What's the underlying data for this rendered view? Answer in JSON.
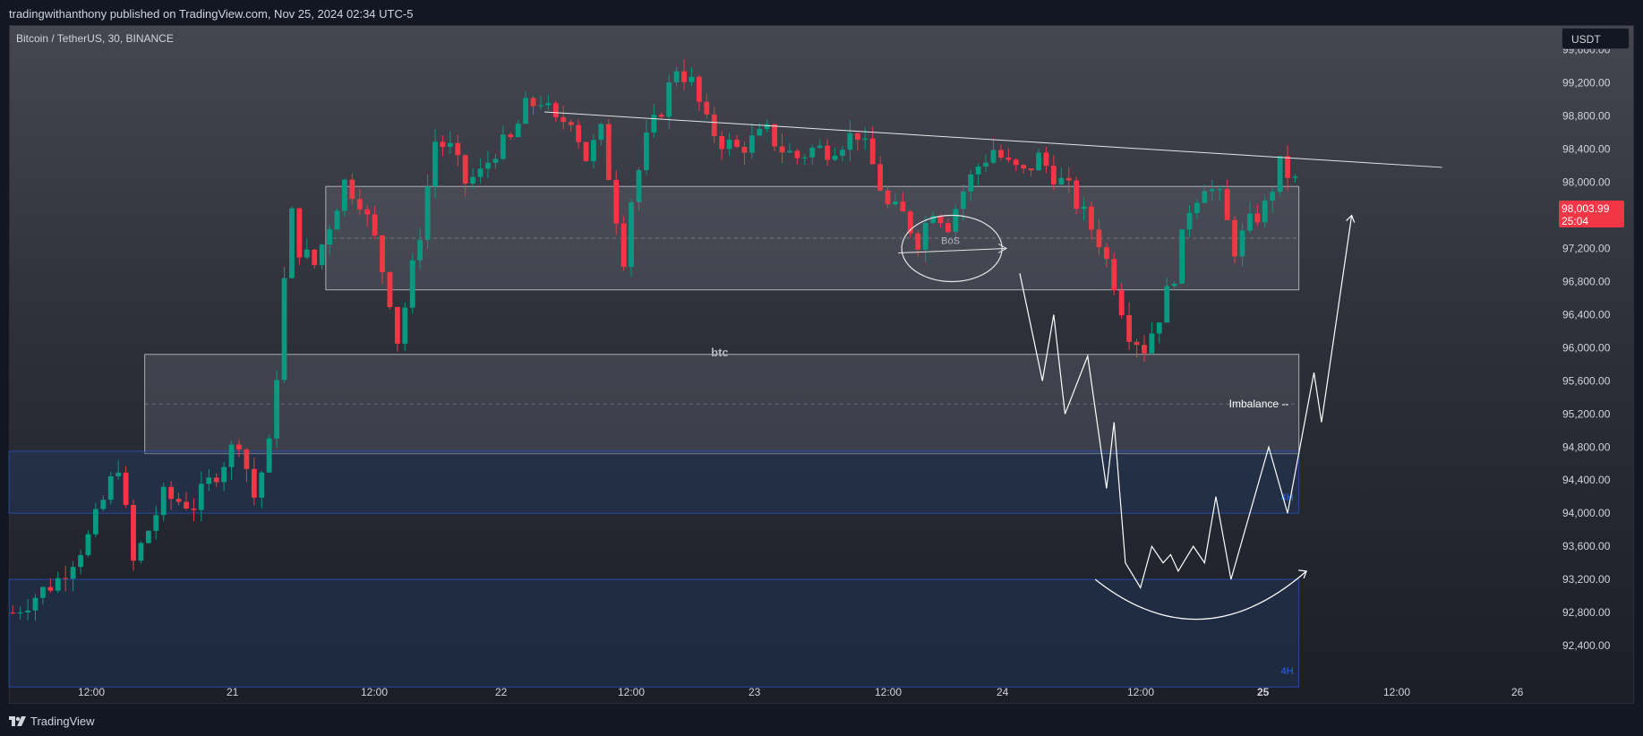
{
  "header": {
    "published_by": "tradingwithanthony published on TradingView.com, Nov 25, 2024 02:34 UTC-5",
    "symbol_line": "Bitcoin / TetherUS, 30, BINANCE",
    "currency": "USDT"
  },
  "last_price": {
    "value": "98,003.99",
    "countdown": "25:04"
  },
  "footer": {
    "brand": "TradingView",
    "logo_icon": "tradingview-logo-icon"
  },
  "colors": {
    "up": "#089981",
    "down": "#f23645",
    "zone_gray": "#787b86",
    "zone_blue": "#2962ff",
    "text": "#d1d4dc",
    "drawing": "#ffffff"
  },
  "chart_data": {
    "type": "candlestick",
    "interval": "30",
    "ylim": [
      92000,
      99900
    ],
    "yticks": [
      "99,600.00",
      "99,200.00",
      "98,800.00",
      "98,400.00",
      "98,000.00",
      "97,600.00",
      "97,200.00",
      "96,800.00",
      "96,400.00",
      "96,000.00",
      "95,600.00",
      "95,200.00",
      "94,800.00",
      "94,400.00",
      "94,000.00",
      "93,600.00",
      "93,200.00",
      "92,800.00",
      "92,400.00"
    ],
    "xticks": [
      "12:00",
      "21",
      "12:00",
      "22",
      "12:00",
      "23",
      "12:00",
      "24",
      "12:00",
      "25",
      "12:00",
      "26"
    ],
    "price_path": [
      [
        0,
        92800
      ],
      [
        6,
        93200
      ],
      [
        10,
        93700
      ],
      [
        14,
        94600
      ],
      [
        16,
        93400
      ],
      [
        20,
        94200
      ],
      [
        24,
        94100
      ],
      [
        27,
        94500
      ],
      [
        30,
        94900
      ],
      [
        32,
        94200
      ],
      [
        34,
        94800
      ],
      [
        35,
        95700
      ],
      [
        36,
        96800
      ],
      [
        37,
        97600
      ],
      [
        38,
        97200
      ],
      [
        40,
        97000
      ],
      [
        42,
        97500
      ],
      [
        44,
        98000
      ],
      [
        46,
        97800
      ],
      [
        48,
        97300
      ],
      [
        50,
        96600
      ],
      [
        51,
        96100
      ],
      [
        52,
        96500
      ],
      [
        54,
        97400
      ],
      [
        56,
        98500
      ],
      [
        58,
        98400
      ],
      [
        60,
        98000
      ],
      [
        62,
        98100
      ],
      [
        64,
        98400
      ],
      [
        66,
        98500
      ],
      [
        68,
        98900
      ],
      [
        70,
        99000
      ],
      [
        72,
        98700
      ],
      [
        74,
        98800
      ],
      [
        76,
        98300
      ],
      [
        78,
        98600
      ],
      [
        80,
        97600
      ],
      [
        81,
        97100
      ],
      [
        82,
        97800
      ],
      [
        84,
        98500
      ],
      [
        86,
        98900
      ],
      [
        88,
        99400
      ],
      [
        90,
        99200
      ],
      [
        92,
        98700
      ],
      [
        94,
        98500
      ],
      [
        96,
        98400
      ],
      [
        98,
        98500
      ],
      [
        100,
        98600
      ],
      [
        102,
        98400
      ],
      [
        104,
        98300
      ],
      [
        106,
        98400
      ],
      [
        108,
        98400
      ],
      [
        110,
        98500
      ],
      [
        112,
        98600
      ],
      [
        114,
        98200
      ],
      [
        116,
        97700
      ],
      [
        118,
        97600
      ],
      [
        120,
        97300
      ],
      [
        122,
        97700
      ],
      [
        124,
        97500
      ],
      [
        126,
        97900
      ],
      [
        128,
        98200
      ],
      [
        130,
        98400
      ],
      [
        132,
        98200
      ],
      [
        134,
        98100
      ],
      [
        136,
        98300
      ],
      [
        138,
        98100
      ],
      [
        140,
        97900
      ],
      [
        142,
        97600
      ],
      [
        144,
        97300
      ],
      [
        146,
        96800
      ],
      [
        148,
        96200
      ],
      [
        150,
        96000
      ],
      [
        152,
        96400
      ],
      [
        154,
        96900
      ],
      [
        156,
        97700
      ],
      [
        158,
        98000
      ],
      [
        160,
        97800
      ],
      [
        162,
        97200
      ],
      [
        164,
        97500
      ],
      [
        166,
        97700
      ],
      [
        168,
        98200
      ],
      [
        170,
        98000
      ]
    ],
    "trendline": {
      "from": [
        71,
        98850
      ],
      "to": [
        190,
        98180
      ]
    },
    "zones": [
      {
        "name": "upper-zone",
        "x": [
          42,
          171
        ],
        "y": [
          96700,
          97950
        ]
      },
      {
        "name": "imbalance-zone",
        "label": "btc",
        "side_label": "Imbalance --",
        "x": [
          18,
          171
        ],
        "y": [
          94720,
          95920
        ]
      },
      {
        "name": "blue-zone-1",
        "label": "4H",
        "x": [
          0,
          171
        ],
        "y": [
          94000,
          94750
        ]
      },
      {
        "name": "blue-zone-2",
        "label": "4H",
        "x": [
          0,
          171
        ],
        "y": [
          91900,
          93200
        ]
      }
    ],
    "annotations": {
      "bos_label": "BoS",
      "projection_path": [
        [
          134,
          96900
        ],
        [
          137,
          95600
        ],
        [
          138.5,
          96400
        ],
        [
          140,
          95200
        ],
        [
          143,
          95900
        ],
        [
          145.5,
          94300
        ],
        [
          146.5,
          95100
        ],
        [
          148,
          93400
        ],
        [
          150,
          93100
        ],
        [
          151.5,
          93600
        ],
        [
          153,
          93400
        ],
        [
          154,
          93500
        ],
        [
          155,
          93300
        ],
        [
          157,
          93600
        ],
        [
          158.5,
          93400
        ],
        [
          160,
          94200
        ],
        [
          162,
          93200
        ],
        [
          167,
          94800
        ],
        [
          169.5,
          94000
        ],
        [
          173,
          95700
        ],
        [
          174,
          95100
        ],
        [
          178,
          97600
        ]
      ],
      "curve": {
        "from": [
          144,
          93200
        ],
        "bottom": [
          158,
          92600
        ],
        "to": [
          172,
          93300
        ]
      }
    }
  }
}
